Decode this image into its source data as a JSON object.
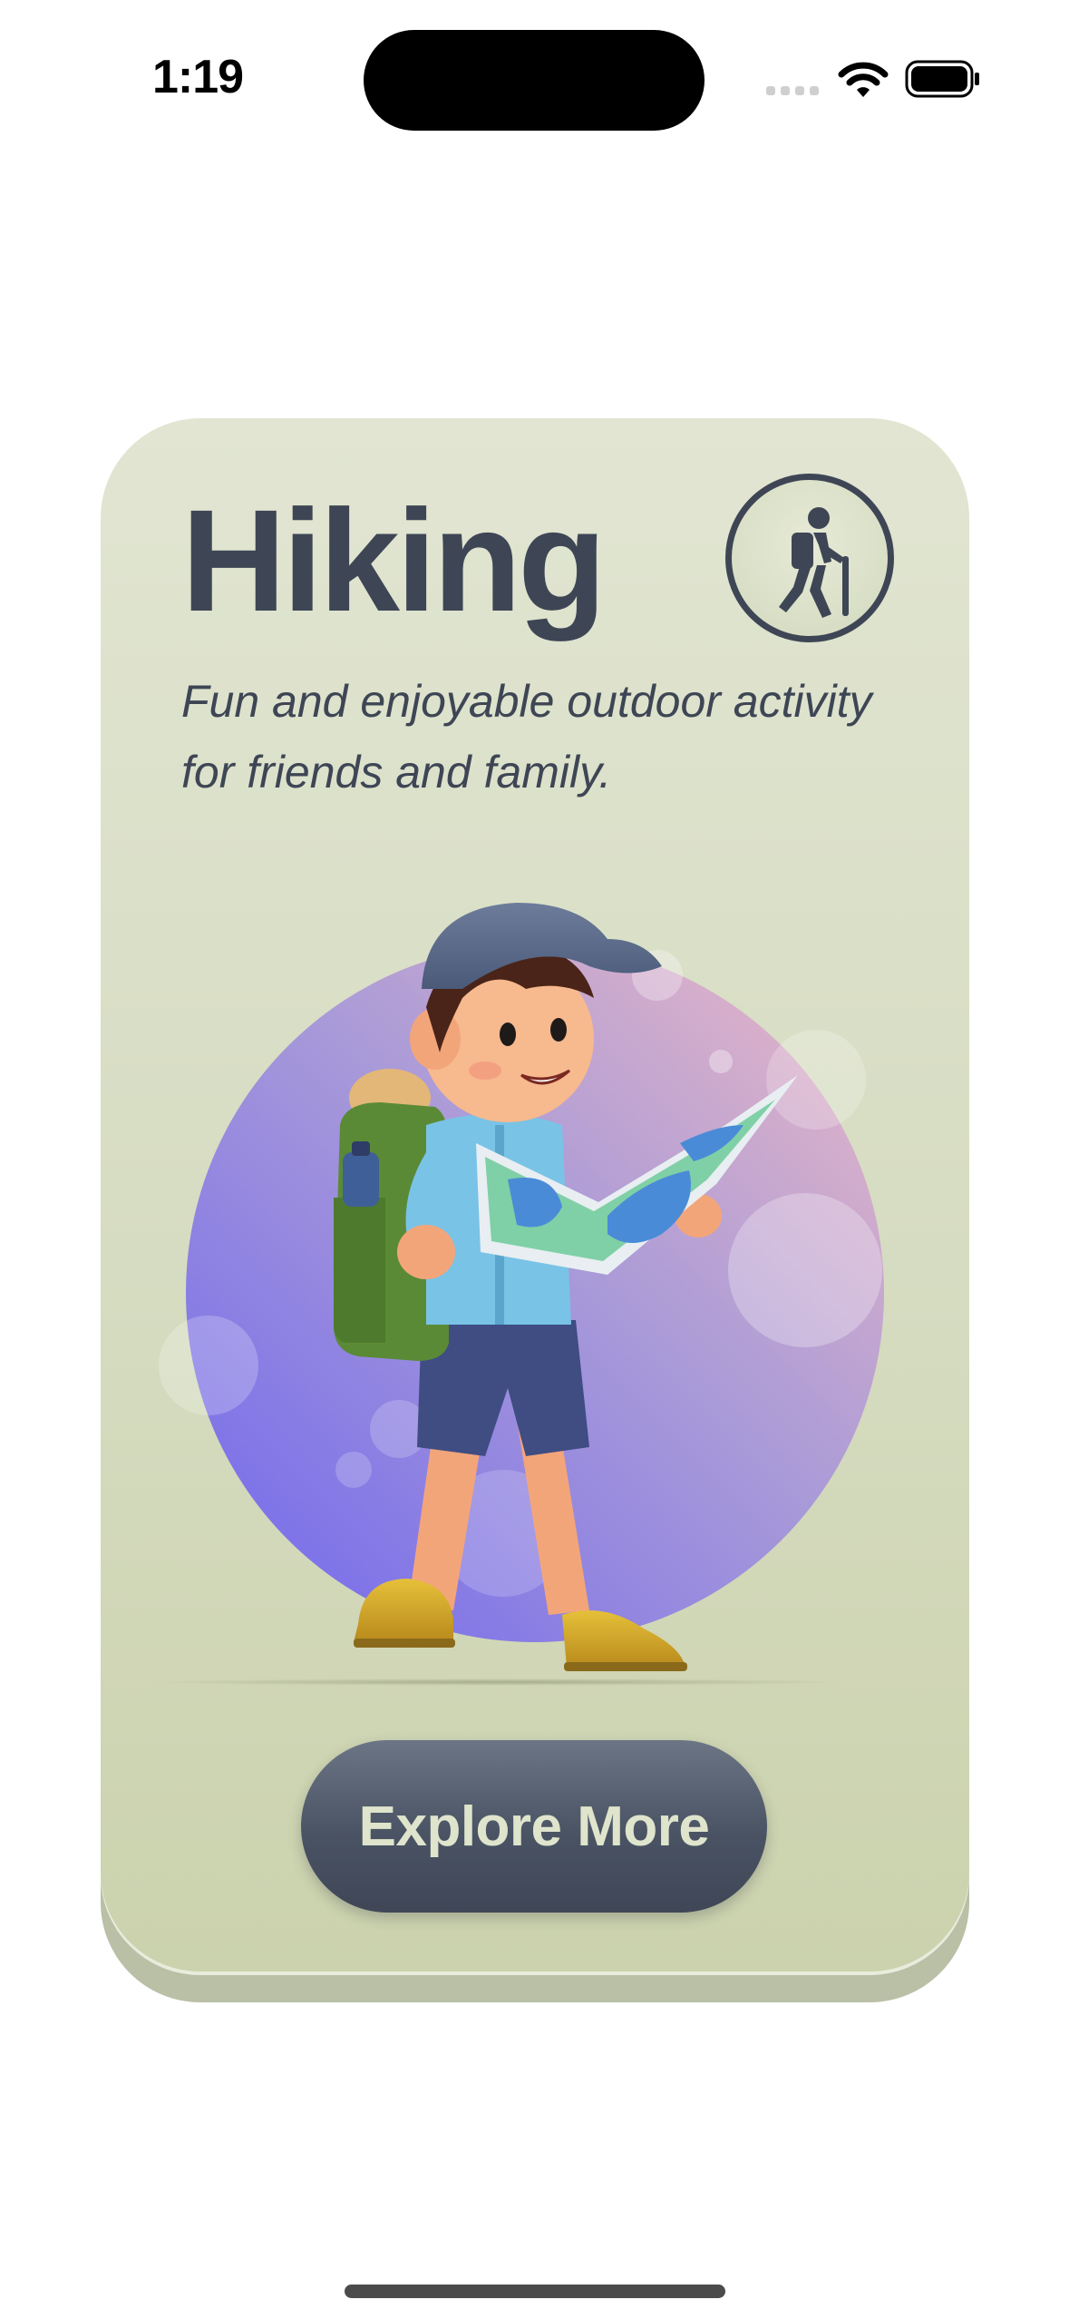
{
  "status_bar": {
    "time": "1:19",
    "icons": [
      "cellular-signal-icon",
      "wifi-icon",
      "battery-icon"
    ]
  },
  "card": {
    "title": "Hiking",
    "subtitle": "Fun and enjoyable outdoor activity for friends and family.",
    "badge_icon": "hiker-icon",
    "illustration": "boy-hiker-reading-map-illustration",
    "button_label": "Explore More"
  },
  "colors": {
    "card_top": "#e1e5d2",
    "card_bottom": "#cbd2ad",
    "text": "#3e4655",
    "button": "#4a5363",
    "button_text": "#dfe4cc",
    "circle_gradient": [
      "#7a6ef0",
      "#e6b4c3"
    ]
  }
}
